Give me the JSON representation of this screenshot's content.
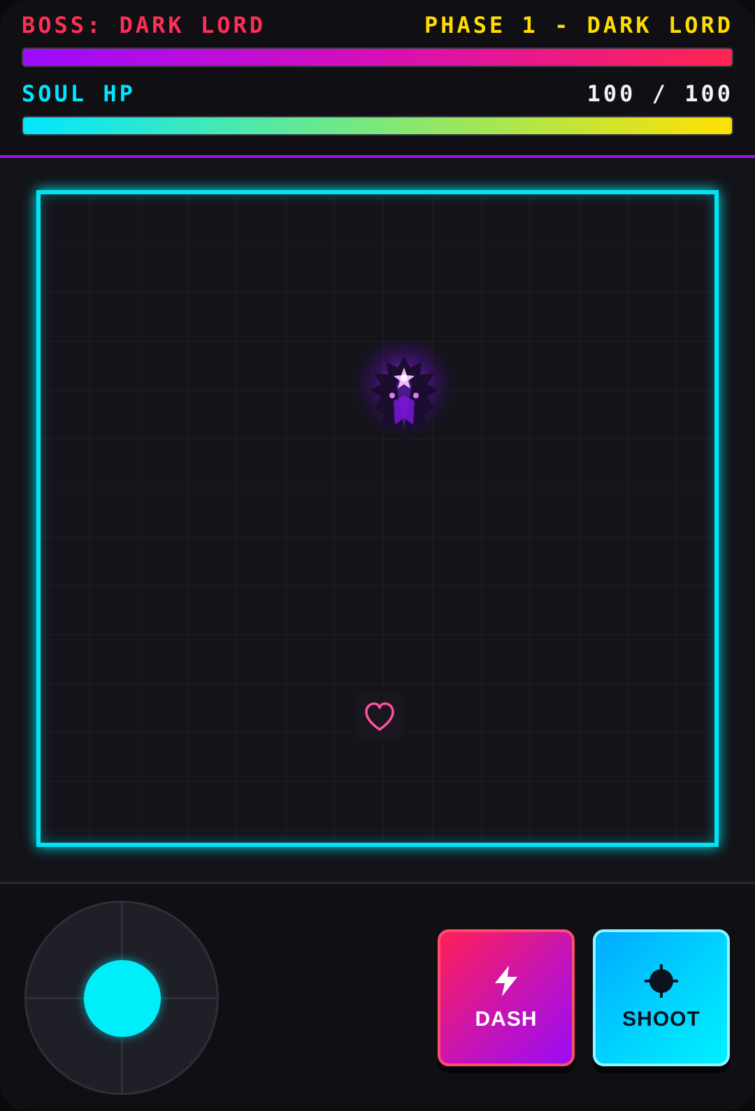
{
  "hud": {
    "boss_label": "BOSS: DARK LORD",
    "phase_label": "PHASE 1 - DARK LORD",
    "boss_hp_fraction": 1.0,
    "soul_label": "SOUL HP",
    "soul_hp_text": "100 / 100",
    "soul_hp_fraction": 1.0
  },
  "arena": {
    "boss_sprite": "dark-lord-sprite",
    "player_icon": "heart-icon"
  },
  "controls": {
    "joystick": "virtual-joystick",
    "dash_label": "DASH",
    "dash_icon": "lightning-icon",
    "shoot_label": "SHOOT",
    "shoot_icon": "crosshair-icon"
  },
  "colors": {
    "arena_border": "#00e5f5",
    "boss_text": "#ff2e55",
    "phase_text": "#ffdc00",
    "soul_text": "#00e6ff",
    "heart": "#ff4fa3",
    "divider_accent": "#9b12f0"
  }
}
